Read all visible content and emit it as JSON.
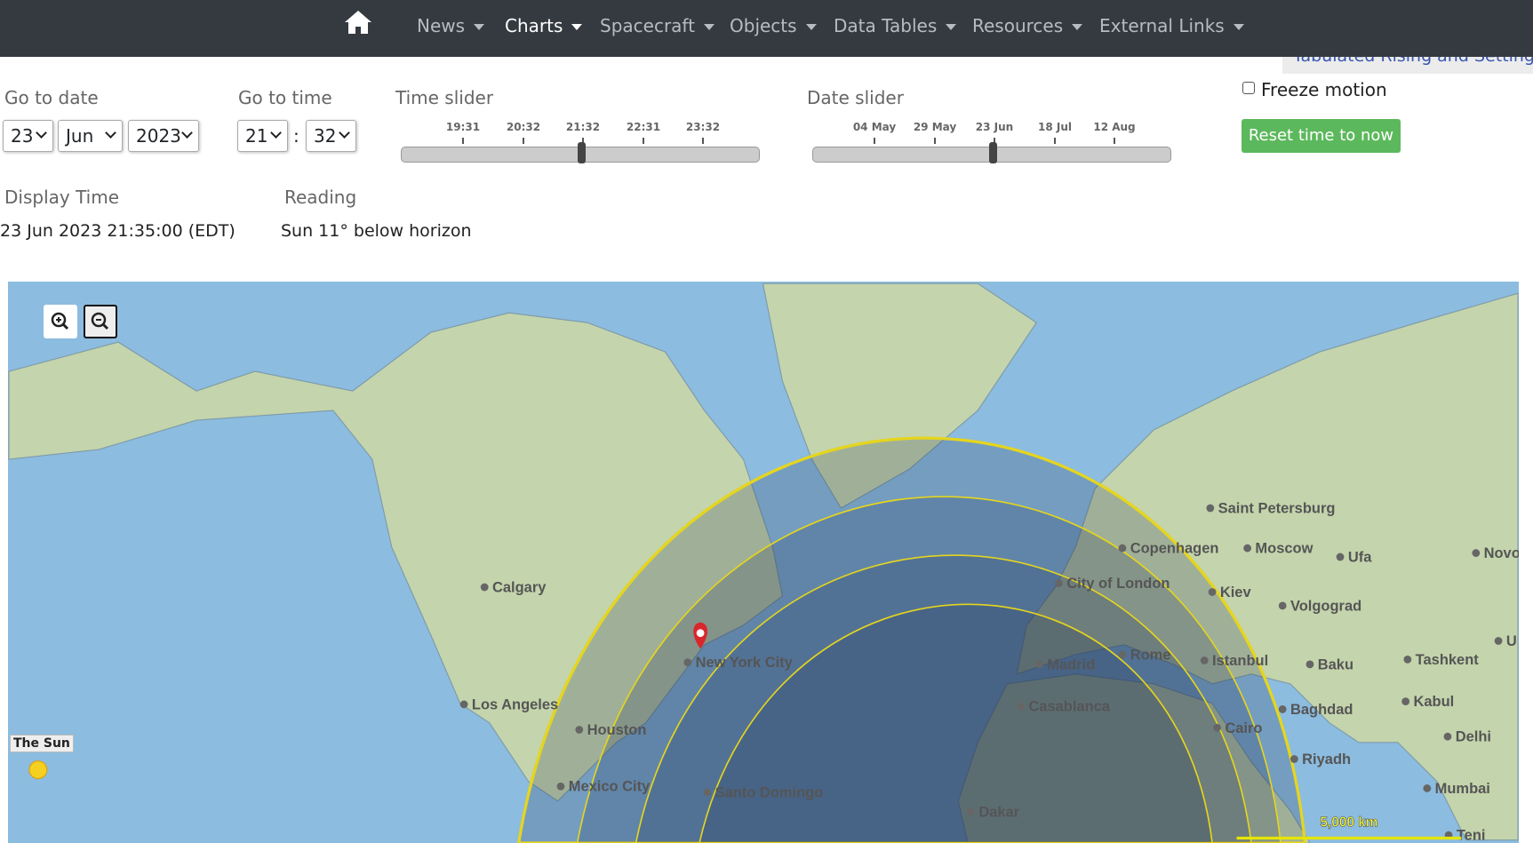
{
  "nav": {
    "items": [
      {
        "label": "News"
      },
      {
        "label": "Charts",
        "active": true
      },
      {
        "label": "Spacecraft"
      },
      {
        "label": "Objects"
      },
      {
        "label": "Data Tables"
      },
      {
        "label": "Resources"
      },
      {
        "label": "External Links"
      }
    ]
  },
  "tooltip": "Tabulated Rising and Setting times",
  "date": {
    "label": "Go to date",
    "day": "23",
    "month": "Jun",
    "year": "2023"
  },
  "time": {
    "label": "Go to time",
    "hour": "21",
    "minute": "32",
    "sep": ":"
  },
  "time_slider": {
    "label": "Time slider",
    "ticks": [
      "19:31",
      "20:32",
      "21:32",
      "22:31",
      "23:32"
    ],
    "value": "21:35"
  },
  "date_slider": {
    "label": "Date slider",
    "ticks": [
      "04 May",
      "29 May",
      "23 Jun",
      "18 Jul",
      "12 Aug"
    ],
    "value": "23 Jun"
  },
  "freeze": {
    "label": "Freeze motion",
    "checked": false
  },
  "reset_label": "Reset time to now",
  "display": {
    "label": "Display Time",
    "value": "23 Jun 2023 21:35:00 (EDT)"
  },
  "reading": {
    "label": "Reading",
    "value": "Sun 11° below horizon"
  },
  "map": {
    "sun_label": "The Sun",
    "scale": "5,000 km",
    "colors": {
      "water": "#8cbcdf",
      "land": "#c4d4ac",
      "night": "#1e3250",
      "terminator": "#e5d51e",
      "pin": "#d9262c"
    },
    "cities": [
      "Saint Petersburg",
      "Copenhagen",
      "Moscow",
      "Ufa",
      "Novo",
      "Calgary",
      "City of London",
      "Kiev",
      "Volgograd",
      "U",
      "New York City",
      "Madrid",
      "Rome",
      "Istanbul",
      "Baku",
      "Tashkent",
      "Los Angeles",
      "Casablanca",
      "Baghdad",
      "Kabul",
      "Houston",
      "Cairo",
      "Delhi",
      "Riyadh",
      "Mexico City",
      "Santo Domingo",
      "Mumbai",
      "Dakar",
      "Teni"
    ]
  }
}
